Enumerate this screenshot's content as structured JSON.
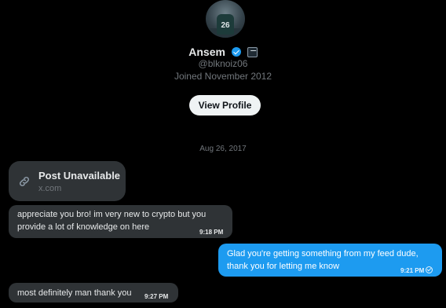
{
  "profile": {
    "avatar_jersey": "26",
    "name": "Ansem",
    "handle": "@blknoiz06",
    "joined": "Joined November 2012",
    "view_profile_label": "View Profile",
    "verified_icon": "verified-badge-icon",
    "affiliate_icon": "affiliate-badge-icon"
  },
  "conversation": {
    "date_separator": "Aug 26, 2017",
    "shared_post": {
      "title": "Post Unavailable",
      "domain": "x.com",
      "icon": "link-icon"
    },
    "messages": [
      {
        "direction": "in",
        "text": "appreciate you bro! im very new to crypto but you provide a lot of knowledge on here",
        "time": "9:18 PM"
      },
      {
        "direction": "out",
        "text": "Glad you're getting something from my feed dude, thank you for letting me know",
        "time": "9:21 PM",
        "status_icon": "read-check-icon"
      },
      {
        "direction": "in",
        "text": "most definitely man thank you",
        "time": "9:27 PM"
      }
    ]
  },
  "colors": {
    "background": "#000000",
    "accent": "#1d9bf0",
    "incoming_bubble": "#2f3336",
    "secondary_text": "#71767b"
  }
}
